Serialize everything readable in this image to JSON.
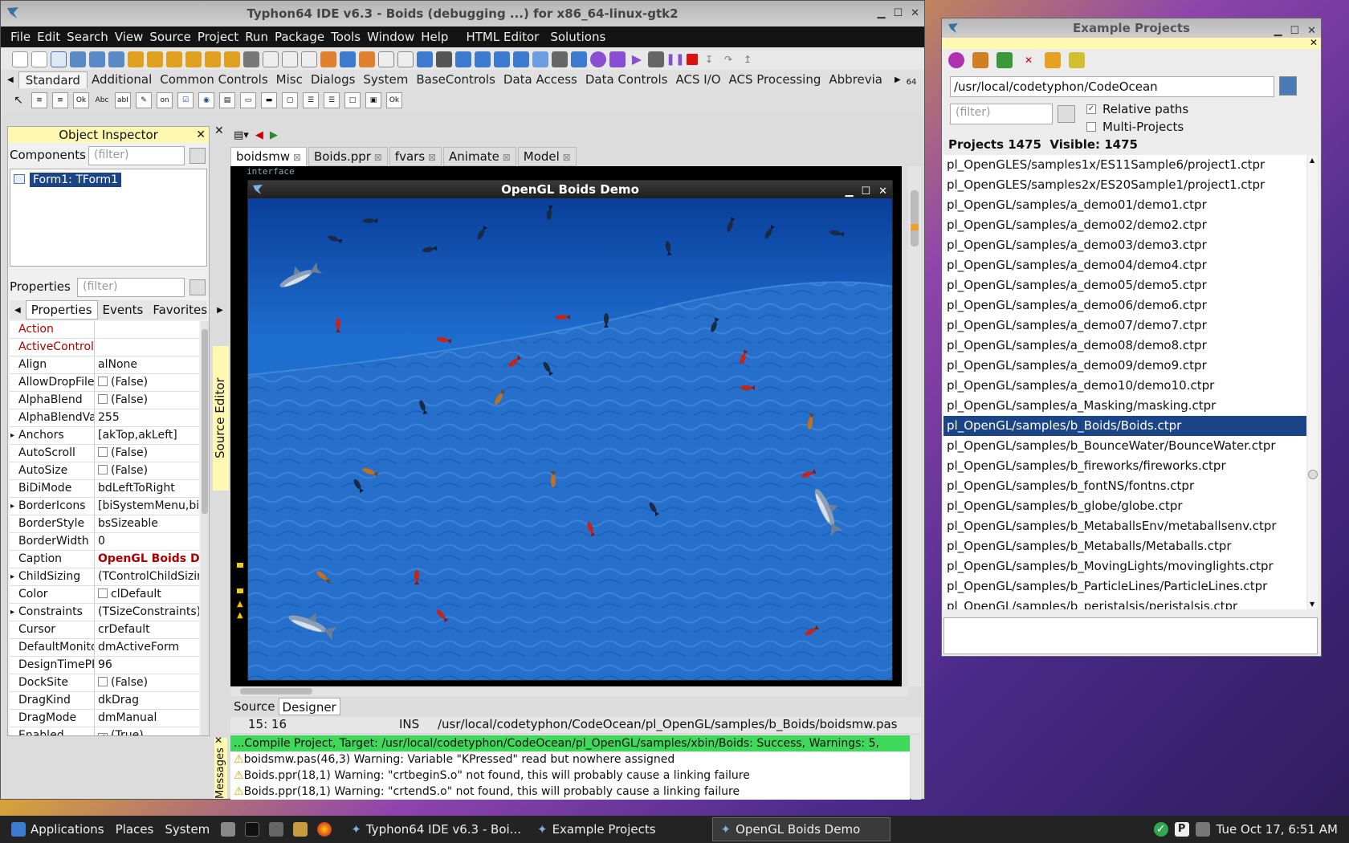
{
  "ide": {
    "title": "Typhon64 IDE v6.3 - Boids (debugging ...) for x86_64-linux-gtk2",
    "menu": [
      "File",
      "Edit",
      "Search",
      "View",
      "Source",
      "Project",
      "Run",
      "Package",
      "Tools",
      "Window",
      "Help"
    ],
    "menu_extra": [
      "HTML Editor",
      "Solutions"
    ],
    "palette_tabs": [
      "Standard",
      "Additional",
      "Common Controls",
      "Misc",
      "Dialogs",
      "System",
      "BaseControls",
      "Data Access",
      "Data Controls",
      "ACS I/O",
      "ACS Processing",
      "Abbrevia"
    ],
    "palette_count": "64"
  },
  "object_inspector": {
    "title": "Object Inspector",
    "components_label": "Components",
    "filter_placeholder": "(filter)",
    "tree_node": "Form1: TForm1",
    "properties_label": "Properties",
    "tabs": [
      "Properties",
      "Events",
      "Favorites"
    ],
    "props": [
      {
        "k": "Action",
        "v": "",
        "red": true
      },
      {
        "k": "ActiveControl",
        "v": "",
        "red": true
      },
      {
        "k": "Align",
        "v": "alNone"
      },
      {
        "k": "AllowDropFiles",
        "v": "(False)",
        "cb": " "
      },
      {
        "k": "AlphaBlend",
        "v": "(False)",
        "cb": " "
      },
      {
        "k": "AlphaBlendValue",
        "v": "255"
      },
      {
        "k": "Anchors",
        "v": "[akTop,akLeft]",
        "exp": true
      },
      {
        "k": "AutoScroll",
        "v": "(False)",
        "cb": " "
      },
      {
        "k": "AutoSize",
        "v": "(False)",
        "cb": " "
      },
      {
        "k": "BiDiMode",
        "v": "bdLeftToRight"
      },
      {
        "k": "BorderIcons",
        "v": "[biSystemMenu,biMinimize",
        "exp": true
      },
      {
        "k": "BorderStyle",
        "v": "bsSizeable"
      },
      {
        "k": "BorderWidth",
        "v": "0"
      },
      {
        "k": "Caption",
        "v": "OpenGL Boids Demo",
        "bold": true
      },
      {
        "k": "ChildSizing",
        "v": "(TControlChildSizing)",
        "exp": true
      },
      {
        "k": "Color",
        "v": "clDefault",
        "cb": " "
      },
      {
        "k": "Constraints",
        "v": "(TSizeConstraints)",
        "exp": true
      },
      {
        "k": "Cursor",
        "v": "crDefault"
      },
      {
        "k": "DefaultMonitor",
        "v": "dmActiveForm"
      },
      {
        "k": "DesignTimePPI",
        "v": "96"
      },
      {
        "k": "DockSite",
        "v": "(False)",
        "cb": " "
      },
      {
        "k": "DragKind",
        "v": "dkDrag"
      },
      {
        "k": "DragMode",
        "v": "dmManual"
      },
      {
        "k": "Enabled",
        "v": "(True)",
        "cb": "✓"
      }
    ]
  },
  "editor": {
    "tabs": [
      "boidsmw",
      "Boids.ppr",
      "fvars",
      "Animate",
      "Model"
    ],
    "code_line": "interface",
    "side_label": "Source Editor",
    "bottom_tabs": [
      "Source",
      "Designer"
    ],
    "status_pos": "15:  16",
    "status_mode": "INS",
    "status_file": "/usr/local/codetyphon/CodeOcean/pl_OpenGL/samples/b_Boids/boidsmw.pas"
  },
  "messages": {
    "label": "Messages",
    "success": "...Compile Project, Target: /usr/local/codetyphon/CodeOcean/pl_OpenGL/samples/xbin/Boids: Success, Warnings: 5,",
    "warnings": [
      "boidsmw.pas(46,3) Warning: Variable \"KPressed\" read but nowhere assigned",
      "Boids.ppr(18,1) Warning: \"crtbeginS.o\" not found, this will probably cause a linking failure",
      "Boids.ppr(18,1) Warning: \"crtendS.o\" not found, this will probably cause a linking failure"
    ]
  },
  "opengl_window": {
    "title": "OpenGL Boids Demo"
  },
  "example_projects": {
    "title": "Example Projects",
    "path": "/usr/local/codetyphon/CodeOcean",
    "filter_placeholder": "(filter)",
    "relative_paths": "Relative paths",
    "multi_projects": "Multi-Projects",
    "counts": "Projects 1475  Visible: 1475",
    "items": [
      "pl_OpenGLES/samples1x/ES11Sample6/project1.ctpr",
      "pl_OpenGLES/samples2x/ES20Sample1/project1.ctpr",
      "pl_OpenGL/samples/a_demo01/demo1.ctpr",
      "pl_OpenGL/samples/a_demo02/demo2.ctpr",
      "pl_OpenGL/samples/a_demo03/demo3.ctpr",
      "pl_OpenGL/samples/a_demo04/demo4.ctpr",
      "pl_OpenGL/samples/a_demo05/demo5.ctpr",
      "pl_OpenGL/samples/a_demo06/demo6.ctpr",
      "pl_OpenGL/samples/a_demo07/demo7.ctpr",
      "pl_OpenGL/samples/a_demo08/demo8.ctpr",
      "pl_OpenGL/samples/a_demo09/demo9.ctpr",
      "pl_OpenGL/samples/a_demo10/demo10.ctpr",
      "pl_OpenGL/samples/a_Masking/masking.ctpr",
      "pl_OpenGL/samples/b_Boids/Boids.ctpr",
      "pl_OpenGL/samples/b_BounceWater/BounceWater.ctpr",
      "pl_OpenGL/samples/b_fireworks/fireworks.ctpr",
      "pl_OpenGL/samples/b_fontNS/fontns.ctpr",
      "pl_OpenGL/samples/b_globe/globe.ctpr",
      "pl_OpenGL/samples/b_MetaballsEnv/metaballsenv.ctpr",
      "pl_OpenGL/samples/b_Metaballs/Metaballs.ctpr",
      "pl_OpenGL/samples/b_MovingLights/movinglights.ctpr",
      "pl_OpenGL/samples/b_ParticleLines/ParticleLines.ctpr",
      "pl_OpenGL/samples/b_peristalsis/peristalsis.ctpr"
    ],
    "selected_index": 13
  },
  "taskbar": {
    "applications": "Applications",
    "places": "Places",
    "system": "System",
    "tasks": [
      "Typhon64 IDE v6.3 - Boi...",
      "Example Projects",
      "OpenGL Boids Demo"
    ],
    "clock": "Tue Oct 17,  6:51 AM"
  },
  "colors": {
    "selection": "#1c4587",
    "success": "#3fd85a",
    "water": "#1d64c4",
    "taskbar": "#232323"
  }
}
